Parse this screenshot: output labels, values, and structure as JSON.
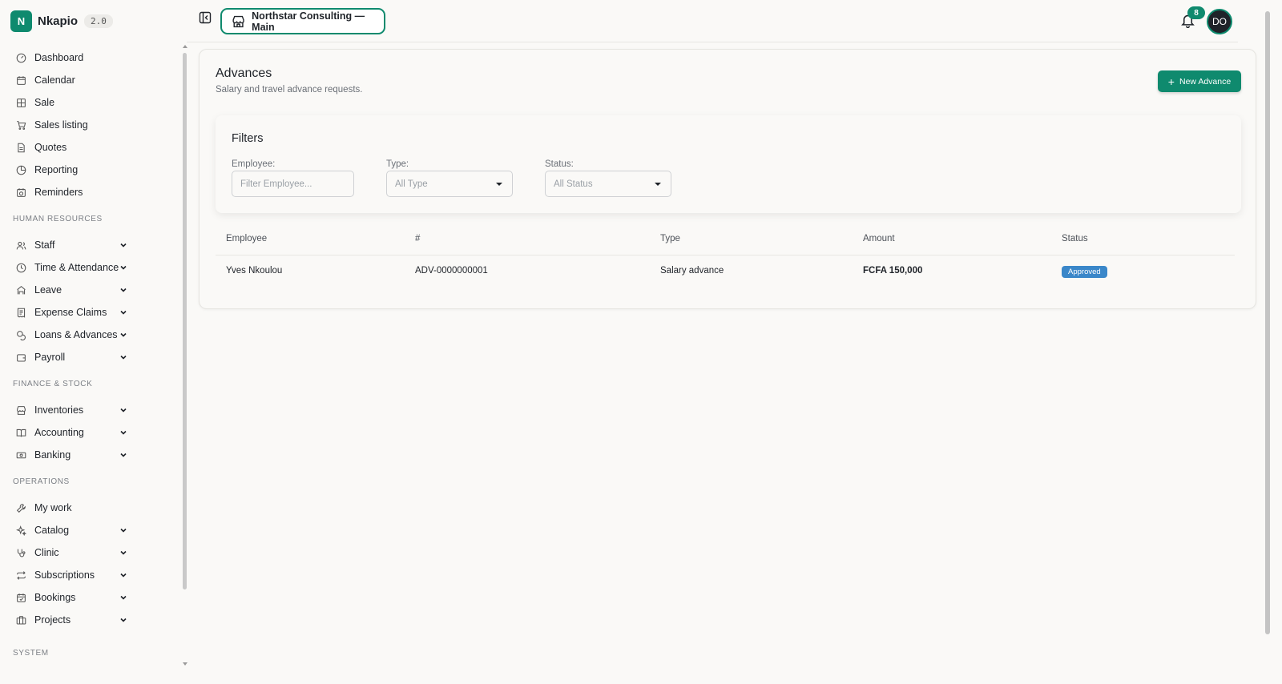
{
  "brand": {
    "initial": "N",
    "name": "Nkapio",
    "version": "2.0"
  },
  "sidebar": {
    "items": [
      {
        "label": "Dashboard",
        "icon": "dashboard-icon"
      },
      {
        "label": "Calendar",
        "icon": "calendar-icon"
      },
      {
        "label": "Sale",
        "icon": "sale-grid-icon"
      },
      {
        "label": "Sales listing",
        "icon": "cart-icon"
      },
      {
        "label": "Quotes",
        "icon": "document-icon"
      },
      {
        "label": "Reporting",
        "icon": "pie-chart-icon"
      },
      {
        "label": "Reminders",
        "icon": "calendar-clock-icon"
      }
    ],
    "sections": [
      {
        "label": "HUMAN RESOURCES",
        "items": [
          {
            "label": "Staff",
            "icon": "users-icon"
          },
          {
            "label": "Time & Attendance",
            "icon": "clock-icon"
          },
          {
            "label": "Leave",
            "icon": "leave-icon"
          },
          {
            "label": "Expense Claims",
            "icon": "receipt-icon"
          },
          {
            "label": "Loans & Advances",
            "icon": "coins-icon"
          },
          {
            "label": "Payroll",
            "icon": "wallet-icon"
          }
        ]
      },
      {
        "label": "FINANCE & STOCK",
        "items": [
          {
            "label": "Inventories",
            "icon": "store-icon"
          },
          {
            "label": "Accounting",
            "icon": "book-icon"
          },
          {
            "label": "Banking",
            "icon": "banknote-icon"
          }
        ]
      },
      {
        "label": "OPERATIONS",
        "items": [
          {
            "label": "My work",
            "icon": "wrench-icon"
          },
          {
            "label": "Catalog",
            "icon": "sparkles-icon"
          },
          {
            "label": "Clinic",
            "icon": "stethoscope-icon"
          },
          {
            "label": "Subscriptions",
            "icon": "repeat-icon"
          },
          {
            "label": "Bookings",
            "icon": "calendar-check-icon"
          },
          {
            "label": "Projects",
            "icon": "briefcase-icon"
          }
        ]
      }
    ],
    "system_label": "SYSTEM"
  },
  "topbar": {
    "organization": "Northstar Consulting — Main",
    "notification_count": "8",
    "avatar_initials": "DO"
  },
  "page": {
    "title": "Advances",
    "subtitle": "Salary and travel advance requests.",
    "new_button_label": "New Advance"
  },
  "filters": {
    "title": "Filters",
    "employee_label": "Employee:",
    "employee_placeholder": "Filter Employee...",
    "type_label": "Type:",
    "type_value": "All Type",
    "status_label": "Status:",
    "status_value": "All Status"
  },
  "table": {
    "columns": [
      "Employee",
      "#",
      "Type",
      "Amount",
      "Status"
    ],
    "rows": [
      {
        "employee": "Yves Nkoulou",
        "number": "ADV-0000000001",
        "type": "Salary advance",
        "amount": "FCFA 150,000",
        "status": "Approved"
      }
    ]
  },
  "colors": {
    "accent": "#0f8a6e",
    "status_approved": "#3a87c9"
  }
}
